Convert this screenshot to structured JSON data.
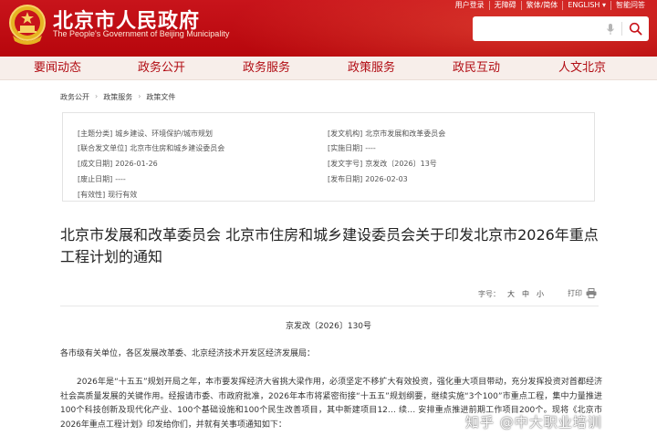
{
  "header": {
    "title_cn": "北京市人民政府",
    "title_en": "The People's Government of Beijing Municipality",
    "top_links": [
      "用户登录",
      "无障碍",
      "繁体/简体",
      "ENGLISH ▾",
      "智能问答"
    ],
    "search": {
      "placeholder": "",
      "value": ""
    },
    "colors": {
      "primary": "#c8141b",
      "nav_bg": "#f7eeea",
      "nav_text": "#b10b12"
    }
  },
  "nav": {
    "items": [
      "要闻动态",
      "政务公开",
      "政务服务",
      "政策服务",
      "政民互动",
      "人文北京"
    ]
  },
  "breadcrumb": [
    "政务公开",
    "政策服务",
    "政策文件"
  ],
  "meta": {
    "topic_label": "[主题分类]",
    "topic_value": "城乡建设、环境保护/城市规划",
    "issuer_label": "[发文机构]",
    "issuer_value": "北京市发展和改革委员会",
    "joint_label": "[联合发文单位]",
    "joint_value": "北京市住房和城乡建设委员会",
    "impl_label": "[实施日期]",
    "impl_value": "----",
    "created_label": "[成文日期]",
    "created_value": "2026-01-26",
    "docno_label": "[发文字号]",
    "docno_value": "京发改〔2026〕13号",
    "abolish_label": "[废止日期]",
    "abolish_value": "----",
    "publish_label": "[发布日期]",
    "publish_value": "2026-02-03",
    "validity_label": "[有效性]",
    "validity_value": "现行有效"
  },
  "document": {
    "title": "北京市发展和改革委员会 北京市住房和城乡建设委员会关于印发北京市2026年重点工程计划的通知",
    "font_size_label": "字号：",
    "sizes": [
      "大",
      "中",
      "小"
    ],
    "print_label": "打印",
    "number": "京发改〔2026〕130号",
    "salutation": "各市级有关单位，各区发展改革委、北京经济技术开发区经济发展局：",
    "paragraph": "2026年是“十五五”规划开局之年，本市要发挥经济大省挑大梁作用，必须坚定不移扩大有效投资，强化重大项目带动，充分发挥投资对首都经济社会高质量发展的关键作用。经报请市委、市政府批准，2026年本市将紧密衔接“十五五”规划纲要，继续实施“3个100”市重点工程，集中力量推进100个科技创新及现代化产业、100个基础设施和100个民生改善项目，其中新建项目12… 续… 安排重点推进前期工作项目200个。现将《北京市2026年重点工程计划》印发给你们，并就有关事项通知如下："
  },
  "watermark": "知乎 @中大职业培训"
}
